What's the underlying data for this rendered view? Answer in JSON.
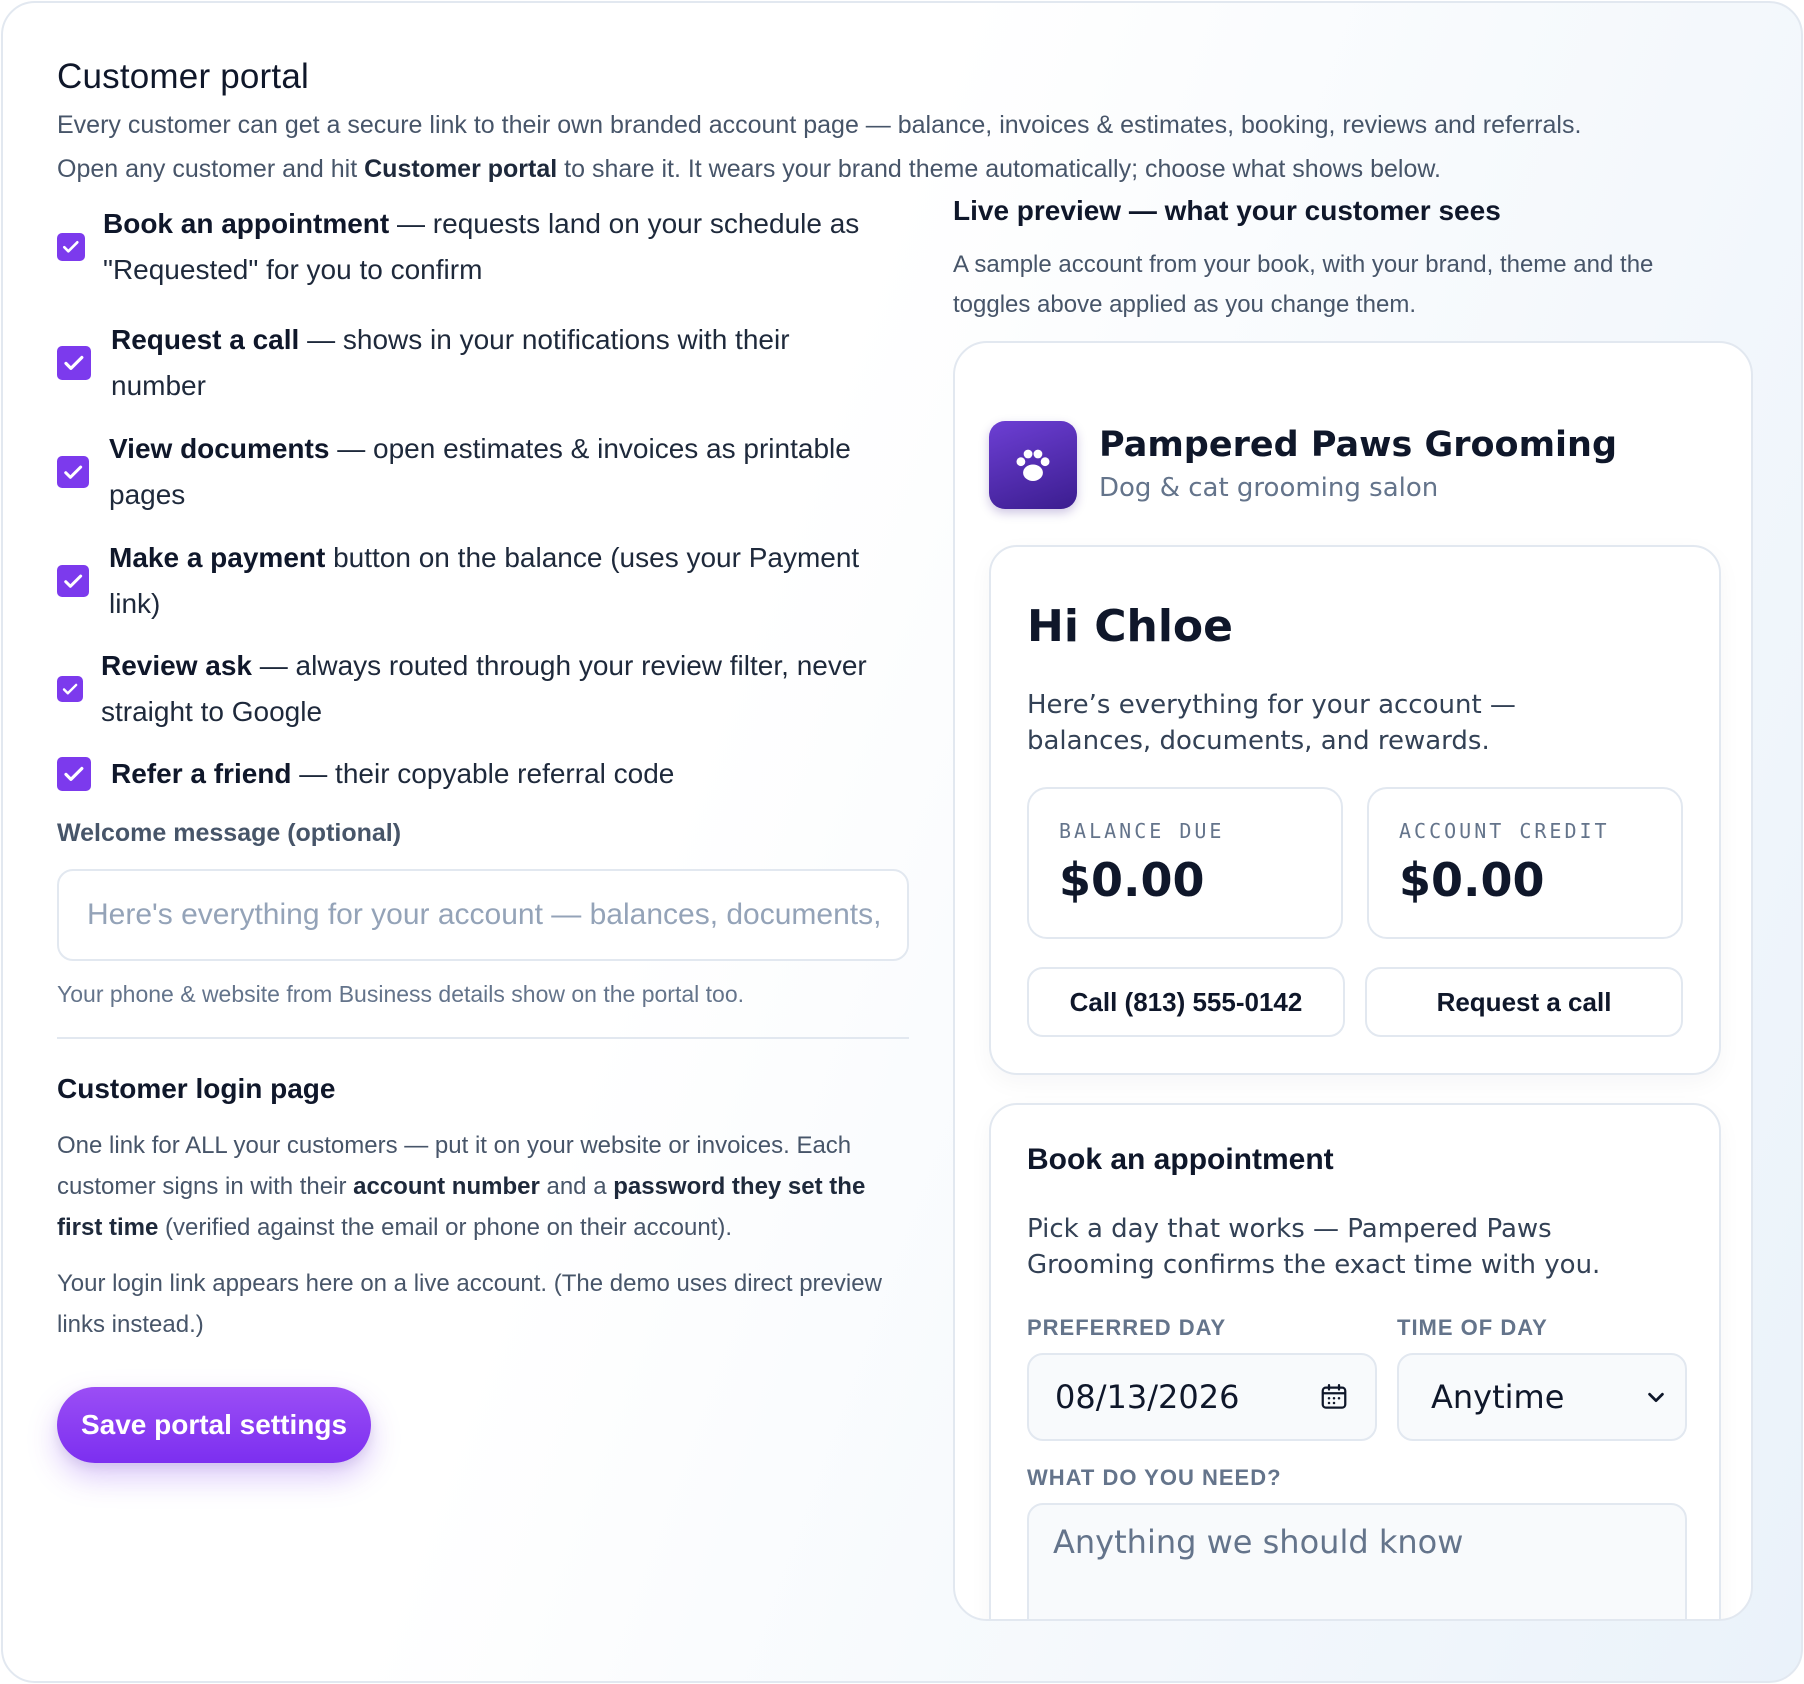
{
  "header": {
    "title": "Customer portal",
    "intro_line1": "Every customer can get a secure link to their own branded account page — balance, invoices & estimates, booking, reviews and referrals.",
    "intro_line2_pre": "Open any customer and hit ",
    "intro_line2_bold": "Customer portal",
    "intro_line2_post": " to share it. It wears your brand theme automatically; choose what shows below."
  },
  "toggles": [
    {
      "bold": "Book an appointment",
      "rest": " — requests land on your schedule as \"Requested\" for you to confirm",
      "checked": true
    },
    {
      "bold": "Request a call",
      "rest": " — shows in your notifications with their number",
      "checked": true
    },
    {
      "bold": "View documents",
      "rest": " — open estimates & invoices as printable pages",
      "checked": true
    },
    {
      "bold": "Make a payment",
      "rest": " button on the balance (uses your Payment link)",
      "checked": true
    },
    {
      "bold": "Review ask",
      "rest": " — always routed through your review filter, never straight to Google",
      "checked": true
    },
    {
      "bold": "Refer a friend",
      "rest": " — their copyable referral code",
      "checked": true
    }
  ],
  "welcome": {
    "label": "Welcome message (optional)",
    "placeholder": "Here's everything for your account — balances, documents, and rewards.",
    "value": "",
    "hint": "Your phone & website from Business details show on the portal too."
  },
  "login": {
    "title": "Customer login page",
    "p1_a": "One link for ALL your customers — put it on your website or invoices. Each customer signs in with their ",
    "p1_b": "account number",
    "p1_c": " and a ",
    "p1_d": "password they set the first time",
    "p1_e": " (verified against the email or phone on their account).",
    "p2": "Your login link appears here on a live account. (The demo uses direct preview links instead.)"
  },
  "save_label": "Save portal settings",
  "live_preview": {
    "title": "Live preview — what your customer sees",
    "description": "A sample account from your book, with your brand, theme and the toggles above applied as you change them.",
    "brand_name": "Pampered Paws Grooming",
    "brand_tagline": "Dog & cat grooming salon",
    "greeting": "Hi Chloe",
    "greeting_sub": "Here’s everything for your account — balances, documents, and rewards.",
    "balance_label": "BALANCE DUE",
    "balance_value": "$0.00",
    "credit_label": "ACCOUNT CREDIT",
    "credit_value": "$0.00",
    "call_button": "Call (813) 555-0142",
    "request_call_button": "Request a call",
    "book_title": "Book an appointment",
    "book_sub": "Pick a day that works — Pampered Paws Grooming confirms the exact time with you.",
    "preferred_day_label": "PREFERRED DAY",
    "preferred_day_value": "08/13/2026",
    "time_of_day_label": "TIME OF DAY",
    "time_of_day_value": "Anytime",
    "need_label": "WHAT DO YOU NEED?",
    "need_placeholder": "Anything we should know"
  },
  "colors": {
    "accent": "#7c3aed",
    "brand_logo": "#4c2aa8",
    "text": "#0f172a",
    "muted": "#475569"
  },
  "icons": [
    "check-icon",
    "paw-icon",
    "calendar-icon",
    "chevron-down-icon"
  ]
}
